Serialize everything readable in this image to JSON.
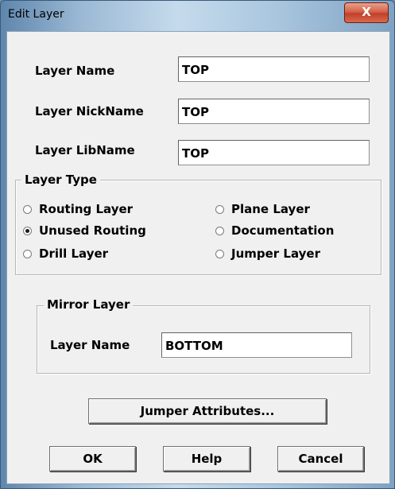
{
  "window": {
    "title": "Edit Layer",
    "close_glyph": "X"
  },
  "fields": {
    "layer_name": {
      "label": "Layer Name",
      "value": "TOP"
    },
    "layer_nickname": {
      "label": "Layer NickName",
      "value": "TOP"
    },
    "layer_libname": {
      "label": "Layer LibName",
      "value": "TOP"
    }
  },
  "layer_type": {
    "title": "Layer Type",
    "options": [
      {
        "label": "Routing Layer",
        "checked": false
      },
      {
        "label": "Unused Routing",
        "checked": true
      },
      {
        "label": "Drill Layer",
        "checked": false
      },
      {
        "label": "Plane Layer",
        "checked": false
      },
      {
        "label": "Documentation",
        "checked": false
      },
      {
        "label": "Jumper Layer",
        "checked": false
      }
    ]
  },
  "mirror_layer": {
    "title": "Mirror Layer",
    "label": "Layer Name",
    "value": "BOTTOM"
  },
  "buttons": {
    "jumper_attributes": "Jumper Attributes...",
    "ok": "OK",
    "help": "Help",
    "cancel": "Cancel"
  }
}
